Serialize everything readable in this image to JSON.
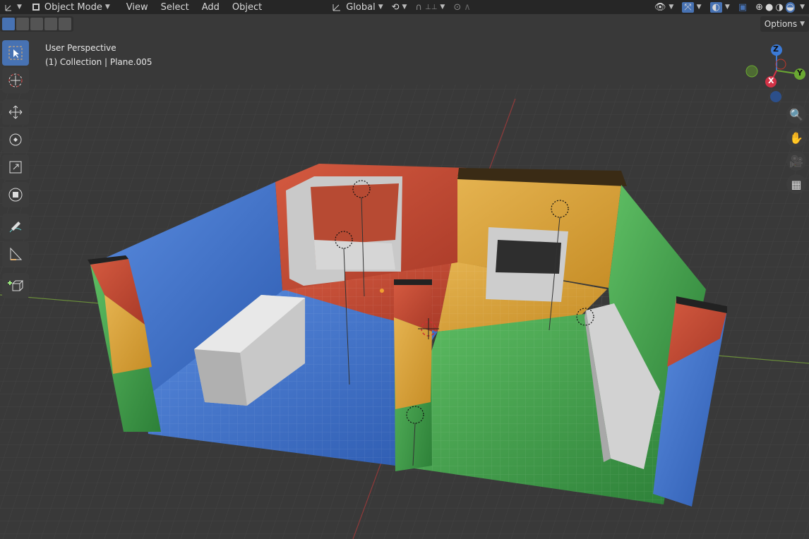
{
  "header": {
    "mode_label": "Object Mode",
    "menus": [
      "View",
      "Select",
      "Add",
      "Object"
    ],
    "transform_orientation": "Global"
  },
  "toolbar": {
    "options_label": "Options"
  },
  "viewport": {
    "perspective_label": "User Perspective",
    "collection_label": "(1) Collection | Plane.005"
  },
  "gizmo": {
    "z_label": "Z",
    "y_label": "Y",
    "x_label": "X"
  },
  "colors": {
    "wall_blue": "#4a7fd6",
    "wall_red": "#c9503a",
    "wall_yellow": "#d8a23a",
    "wall_green": "#3f9a48",
    "floor_grid": "#383838",
    "ui_bg": "#262626",
    "active_tool": "#4772b3"
  }
}
